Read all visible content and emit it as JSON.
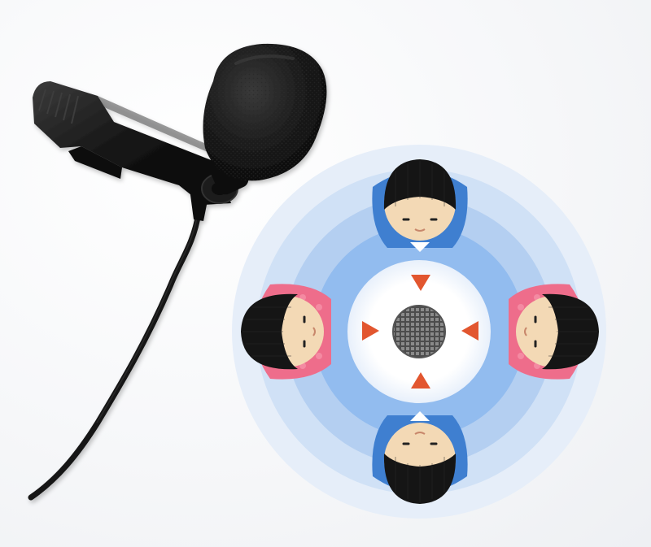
{
  "scene": {
    "caption": "",
    "microphone": {
      "icon": "lavalier-microphone-icon",
      "colors": {
        "foam": "#1a1a1a",
        "clip": "#111111",
        "cable": "#141414"
      }
    },
    "pickup_pattern": {
      "icon": "omnidirectional-pattern-icon",
      "colors": {
        "ring_outer": "#dbe8f7",
        "ring_mid": "#b9d3f1",
        "ring_inner": "#8ebbf0",
        "center_glow": "#ffffff",
        "arrow": "#e2562f",
        "mesh": "#5a5a5a"
      },
      "people": [
        {
          "position": "top",
          "shirt": "#3f7fd0",
          "hair": "#151515",
          "skin": "#f3d9b5"
        },
        {
          "position": "left",
          "shirt": "#ee6d8b",
          "hair": "#151515",
          "skin": "#f3d9b5"
        },
        {
          "position": "right",
          "shirt": "#ee6d8b",
          "hair": "#151515",
          "skin": "#f3d9b5"
        },
        {
          "position": "bottom",
          "shirt": "#3f7fd0",
          "hair": "#151515",
          "skin": "#f3d9b5"
        }
      ]
    }
  }
}
